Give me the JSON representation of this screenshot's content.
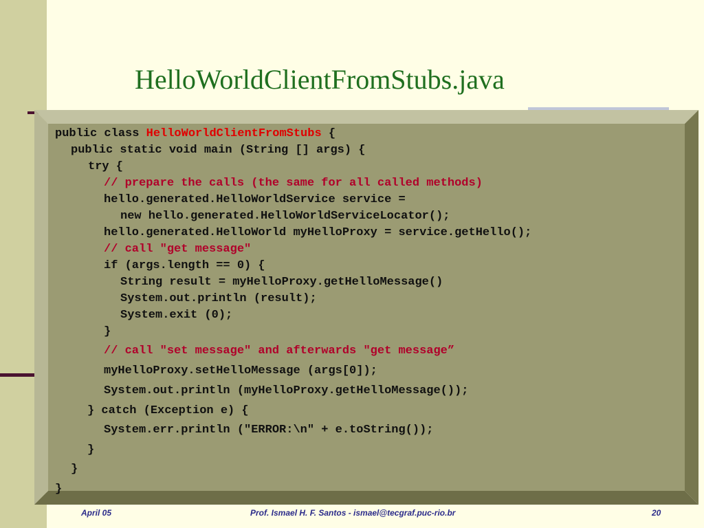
{
  "slide": {
    "title": "HelloWorldClientFromStubs.java"
  },
  "code": {
    "line1_prefix": "public class ",
    "line1_class": "HelloWorldClientFromStubs",
    "line1_suffix": " {",
    "line2": "public static void main (String [] args) {",
    "line3": "try {",
    "line4": "// prepare the calls (the same for all called methods)",
    "line5": "hello.generated.HelloWorldService service =",
    "line6": "new hello.generated.HelloWorldServiceLocator();",
    "line7": "hello.generated.HelloWorld myHelloProxy = service.getHello();",
    "line8": "// call \"get message\"",
    "line9": "if (args.length == 0) {",
    "line10": "String result = myHelloProxy.getHelloMessage()",
    "line11": "System.out.println (result);",
    "line12": "System.exit (0);",
    "line13": "}",
    "line14": "// call \"set message\" and afterwards \"get message”",
    "line15": "myHelloProxy.setHelloMessage (args[0]);",
    "line16": "System.out.println (myHelloProxy.getHelloMessage());",
    "line17": "} catch (Exception e) {",
    "line18": "System.err.println (\"ERROR:\\n\" + e.toString());",
    "line19": "}",
    "line20": "}",
    "line21": "}"
  },
  "footer": {
    "date": "April 05",
    "author": "Prof. Ismael H. F. Santos -  ismael@tecgraf.puc-rio.br",
    "page": "20"
  },
  "colors": {
    "title": "#1f6f1f",
    "comment": "#b0002a",
    "class_name": "#e00000",
    "box_face": "#9b9b73",
    "footer": "#2b2b8a"
  }
}
